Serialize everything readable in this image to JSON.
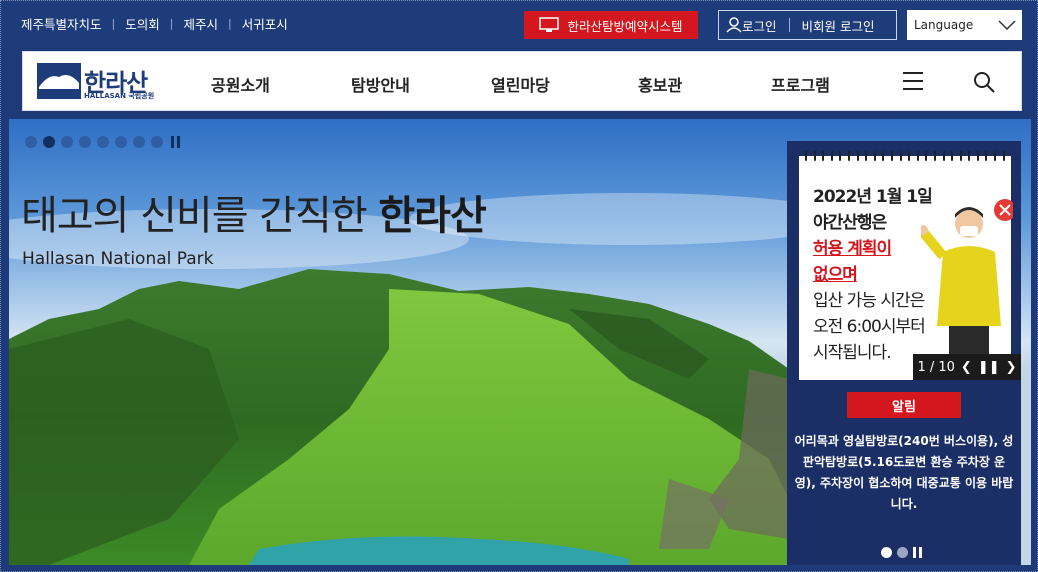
{
  "util_links": [
    "제주특별자치도",
    "도의회",
    "제주시",
    "서귀포시"
  ],
  "reserve_button": "한라산탐방예약시스템",
  "auth": {
    "login": "로그인",
    "guest_login": "비회원 로그인"
  },
  "language": {
    "selected": "Language"
  },
  "logo": {
    "kr": "한라산",
    "en": "HALLASAN 국립공원"
  },
  "nav": [
    "공원소개",
    "탐방안내",
    "열린마당",
    "홍보관",
    "프로그램"
  ],
  "hero": {
    "title_plain": "태고의 신비를 간직한 ",
    "title_bold": "한라산",
    "subtitle": "Hallasan National Park",
    "slide_count": 8,
    "active_slide": 2
  },
  "popup": {
    "line1": "2022년 1월 1일",
    "line2": "야간산행은",
    "line3": "허용 계획이",
    "line4": "없으며",
    "line5": "입산 가능 시간은",
    "line6": "오전 6:00시부터",
    "line7": "시작됩니다.",
    "pager": "1 / 10"
  },
  "notice": {
    "label": "알림",
    "text": "어리목과 영실탐방로(240번 버스이용), 성판악탐방로(5.16도로변 환승 주차장 운영), 주차장이 협소하여 대중교통 이용 바랍니다."
  },
  "colors": {
    "primary": "#1e3b7a",
    "accent_red": "#d4161f"
  }
}
